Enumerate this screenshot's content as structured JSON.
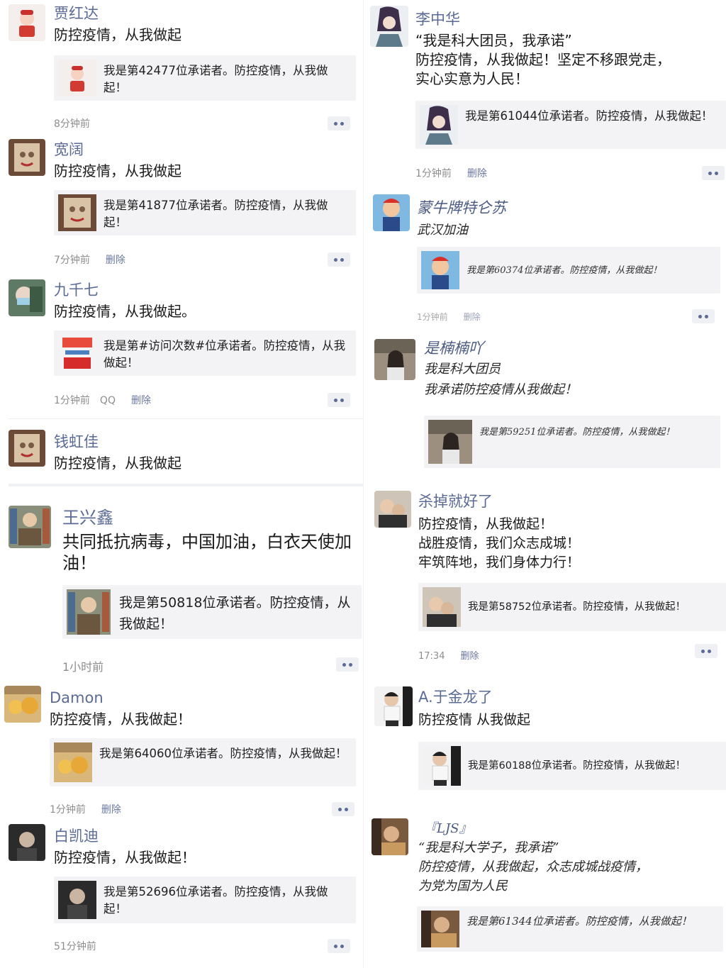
{
  "left_posts": [
    {
      "name": "贾红达",
      "text": "防控疫情，从我做起",
      "card_text": "我是第42477位承诺者。防控疫情，从我做起！",
      "time": "8分钟前",
      "delete": "",
      "extra": ""
    },
    {
      "name": "宽阔",
      "text": "防控疫情，从我做起",
      "card_text": "我是第41877位承诺者。防控疫情，从我做起！",
      "time": "7分钟前",
      "delete": "删除",
      "extra": ""
    },
    {
      "name": "九千七",
      "text": "防控疫情，从我做起。",
      "card_text": "我是第#访问次数#位承诺者。防控疫情，从我做起！",
      "time": "1分钟前",
      "delete": "删除",
      "extra": "QQ"
    },
    {
      "name": "钱虹佳",
      "text": "防控疫情，从我做起",
      "card_text": "",
      "time": "",
      "delete": "",
      "extra": ""
    },
    {
      "name": "王兴鑫",
      "text": "共同抵抗病毒，中国加油，白衣天使加油！",
      "card_text": "我是第50818位承诺者。防控疫情，从我做起！",
      "time": "1小时前",
      "delete": "",
      "extra": ""
    },
    {
      "name": "Damon",
      "text": "防控疫情，从我做起！",
      "card_text": "我是第64060位承诺者。防控疫情，从我做起！",
      "time": "1分钟前",
      "delete": "删除",
      "extra": ""
    },
    {
      "name": "白凯迪",
      "text": "防控疫情，从我做起！",
      "card_text": "我是第52696位承诺者。防控疫情，从我做起！",
      "time": "51分钟前",
      "delete": "",
      "extra": ""
    }
  ],
  "right_posts": [
    {
      "name": "李中华",
      "text": "“我是科大团员，我承诺”\n防控疫情，从我做起！坚定不移跟党走，\n实心实意为人民！",
      "card_text": "我是第61044位承诺者。防控疫情，从我做起！",
      "time": "1分钟前",
      "delete": "删除"
    },
    {
      "name": "蒙牛牌特仑苏",
      "text": "武汉加油",
      "card_text": "我是第60374位承诺者。防控疫情，从我做起！",
      "time": "1分钟前",
      "delete": "删除"
    },
    {
      "name": "是楠楠吖",
      "text": "我是科大团员\n我承诺防控疫情从我做起！",
      "card_text": "我是第59251位承诺者。防控疫情，从我做起！",
      "time": "",
      "delete": ""
    },
    {
      "name": "杀掉就好了",
      "text": "防控疫情，从我做起！\n战胜疫情，我们众志成城！\n牢筑阵地，我们身体力行！",
      "card_text": "我是第58752位承诺者。防控疫情，从我做起！",
      "time": "17:34",
      "delete": "删除"
    },
    {
      "name": "A.于金龙了",
      "text": "防控疫情 从我做起",
      "card_text": "我是第60188位承诺者。防控疫情，从我做起！",
      "time": "",
      "delete": ""
    },
    {
      "name": "『LJS』",
      "text": "“我是科大学子，我承诺”\n防控疫情，从我做起，众志成城战疫情，\n为党为国为人民",
      "card_text": "我是第61344位承诺者。防控疫情，从我做起！",
      "time": "",
      "delete": ""
    }
  ],
  "icons": {
    "more": "more-dots-icon",
    "avatar": "user-avatar-image"
  },
  "colors": {
    "name": "#5b6b95",
    "card_bg": "#f3f3f5",
    "meta": "#8d8d8d"
  }
}
